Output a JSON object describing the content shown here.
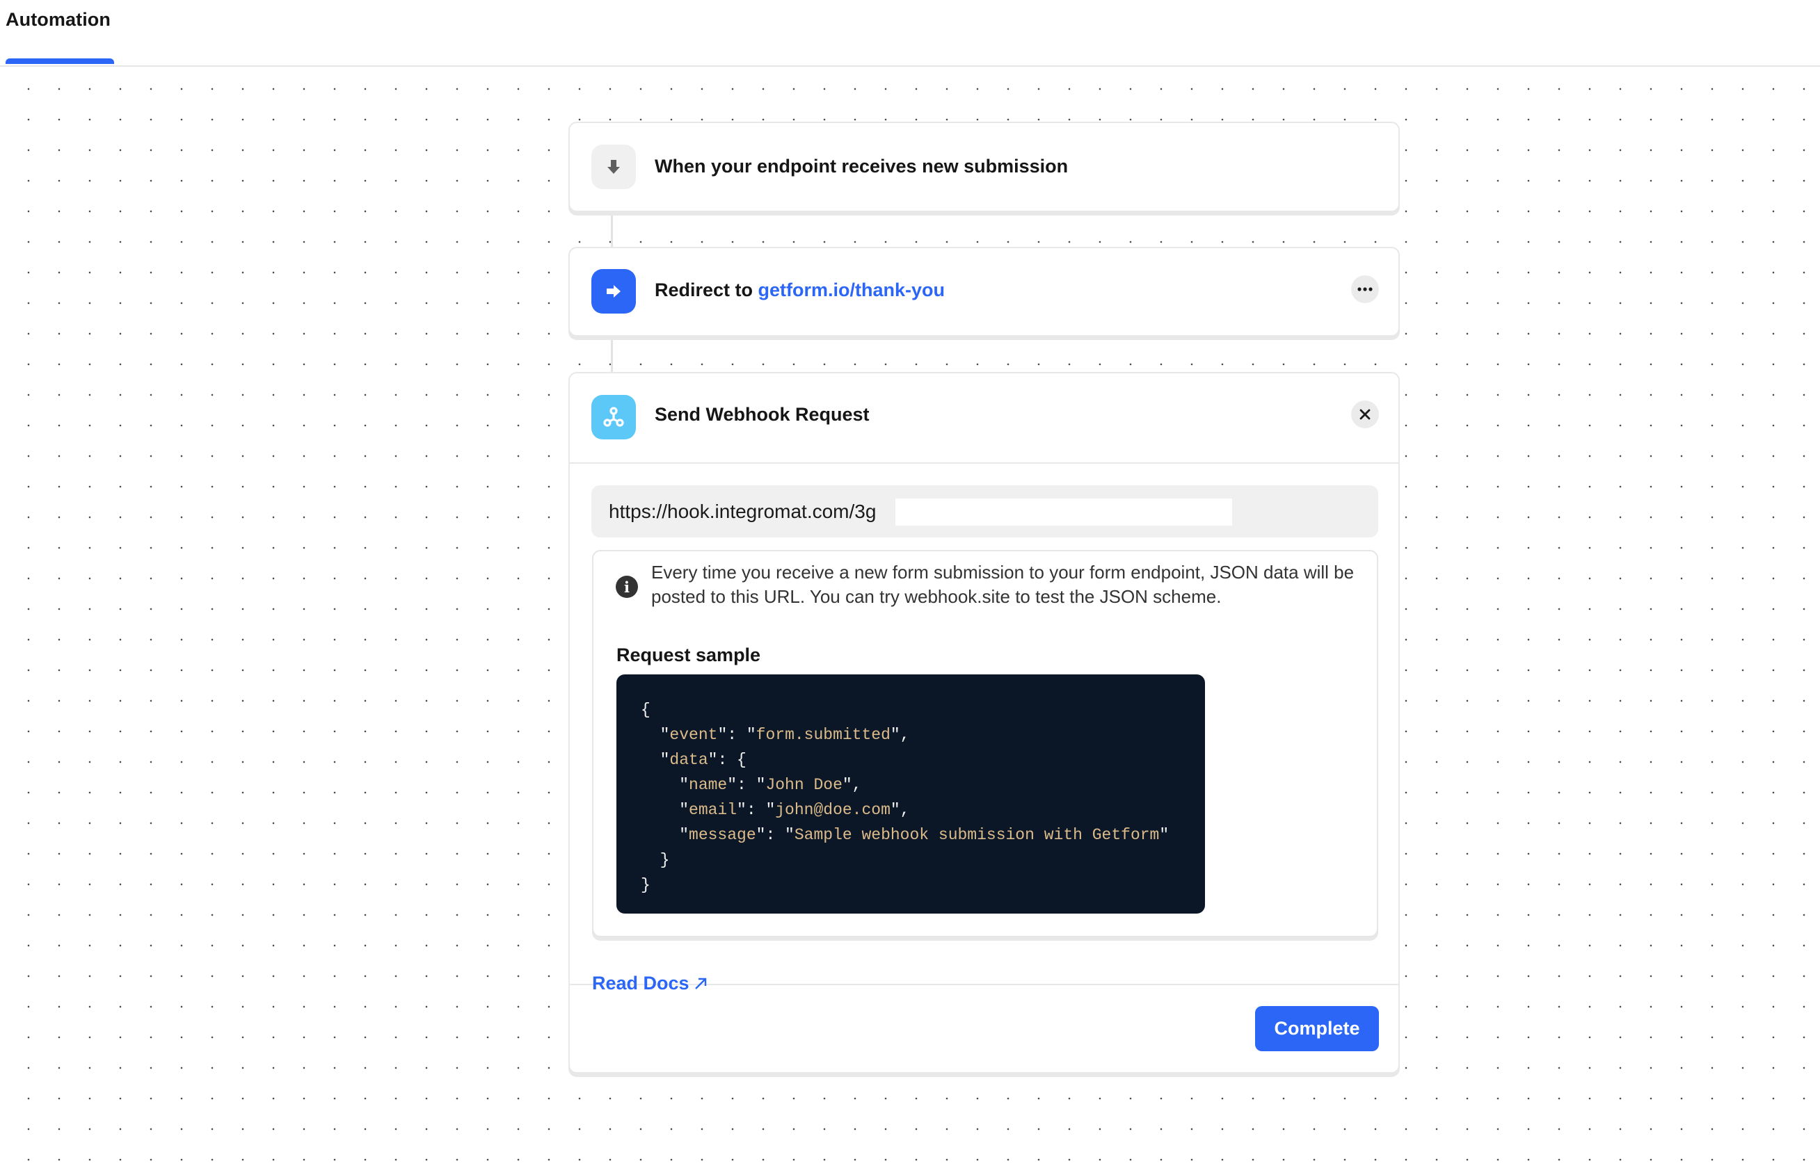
{
  "header": {
    "tabs": [
      {
        "label": "Automation",
        "active": true
      }
    ]
  },
  "colors": {
    "accent": "#2b66f6",
    "webhook_icon_bg": "#5bc8f8",
    "trigger_icon_bg": "#f0f0f0",
    "code_bg": "#0b1727",
    "code_string": "#dcbb8b"
  },
  "steps": [
    {
      "type": "trigger",
      "icon": "arrow-down-icon",
      "title": "When your endpoint receives new submission"
    },
    {
      "type": "redirect",
      "icon": "arrow-right-icon",
      "title_prefix": "Redirect to",
      "link_text": "getform.io/thank-you",
      "menu_icon": "more-horizontal-icon"
    },
    {
      "type": "webhook",
      "icon": "webhook-icon",
      "title": "Send Webhook Request",
      "close_icon": "close-icon",
      "url_value": "https://hook.integromat.com/3g",
      "info_icon": "info-icon",
      "info_text": "Every time you receive a new form submission to your form endpoint, JSON data will be posted to this URL. You can try webhook.site to test the JSON scheme.",
      "request_sample_label": "Request sample",
      "code_lines": [
        [
          {
            "t": "{",
            "c": "p"
          }
        ],
        [
          {
            "t": "  \"",
            "c": "p"
          },
          {
            "t": "event",
            "c": "s"
          },
          {
            "t": "\": \"",
            "c": "p"
          },
          {
            "t": "form.submitted",
            "c": "s"
          },
          {
            "t": "\",",
            "c": "p"
          }
        ],
        [
          {
            "t": "  \"",
            "c": "p"
          },
          {
            "t": "data",
            "c": "s"
          },
          {
            "t": "\": {",
            "c": "p"
          }
        ],
        [
          {
            "t": "    \"",
            "c": "p"
          },
          {
            "t": "name",
            "c": "s"
          },
          {
            "t": "\": \"",
            "c": "p"
          },
          {
            "t": "John Doe",
            "c": "s"
          },
          {
            "t": "\",",
            "c": "p"
          }
        ],
        [
          {
            "t": "    \"",
            "c": "p"
          },
          {
            "t": "email",
            "c": "s"
          },
          {
            "t": "\": \"",
            "c": "p"
          },
          {
            "t": "john@doe.com",
            "c": "s"
          },
          {
            "t": "\",",
            "c": "p"
          }
        ],
        [
          {
            "t": "    \"",
            "c": "p"
          },
          {
            "t": "message",
            "c": "s"
          },
          {
            "t": "\": \"",
            "c": "p"
          },
          {
            "t": "Sample webhook submission with Getform",
            "c": "s"
          },
          {
            "t": "\"",
            "c": "p"
          }
        ],
        [
          {
            "t": "  }",
            "c": "p"
          }
        ],
        [
          {
            "t": "}",
            "c": "p"
          }
        ]
      ],
      "read_docs_label": "Read Docs",
      "read_docs_icon": "external-link-arrow-icon",
      "complete_label": "Complete"
    }
  ]
}
